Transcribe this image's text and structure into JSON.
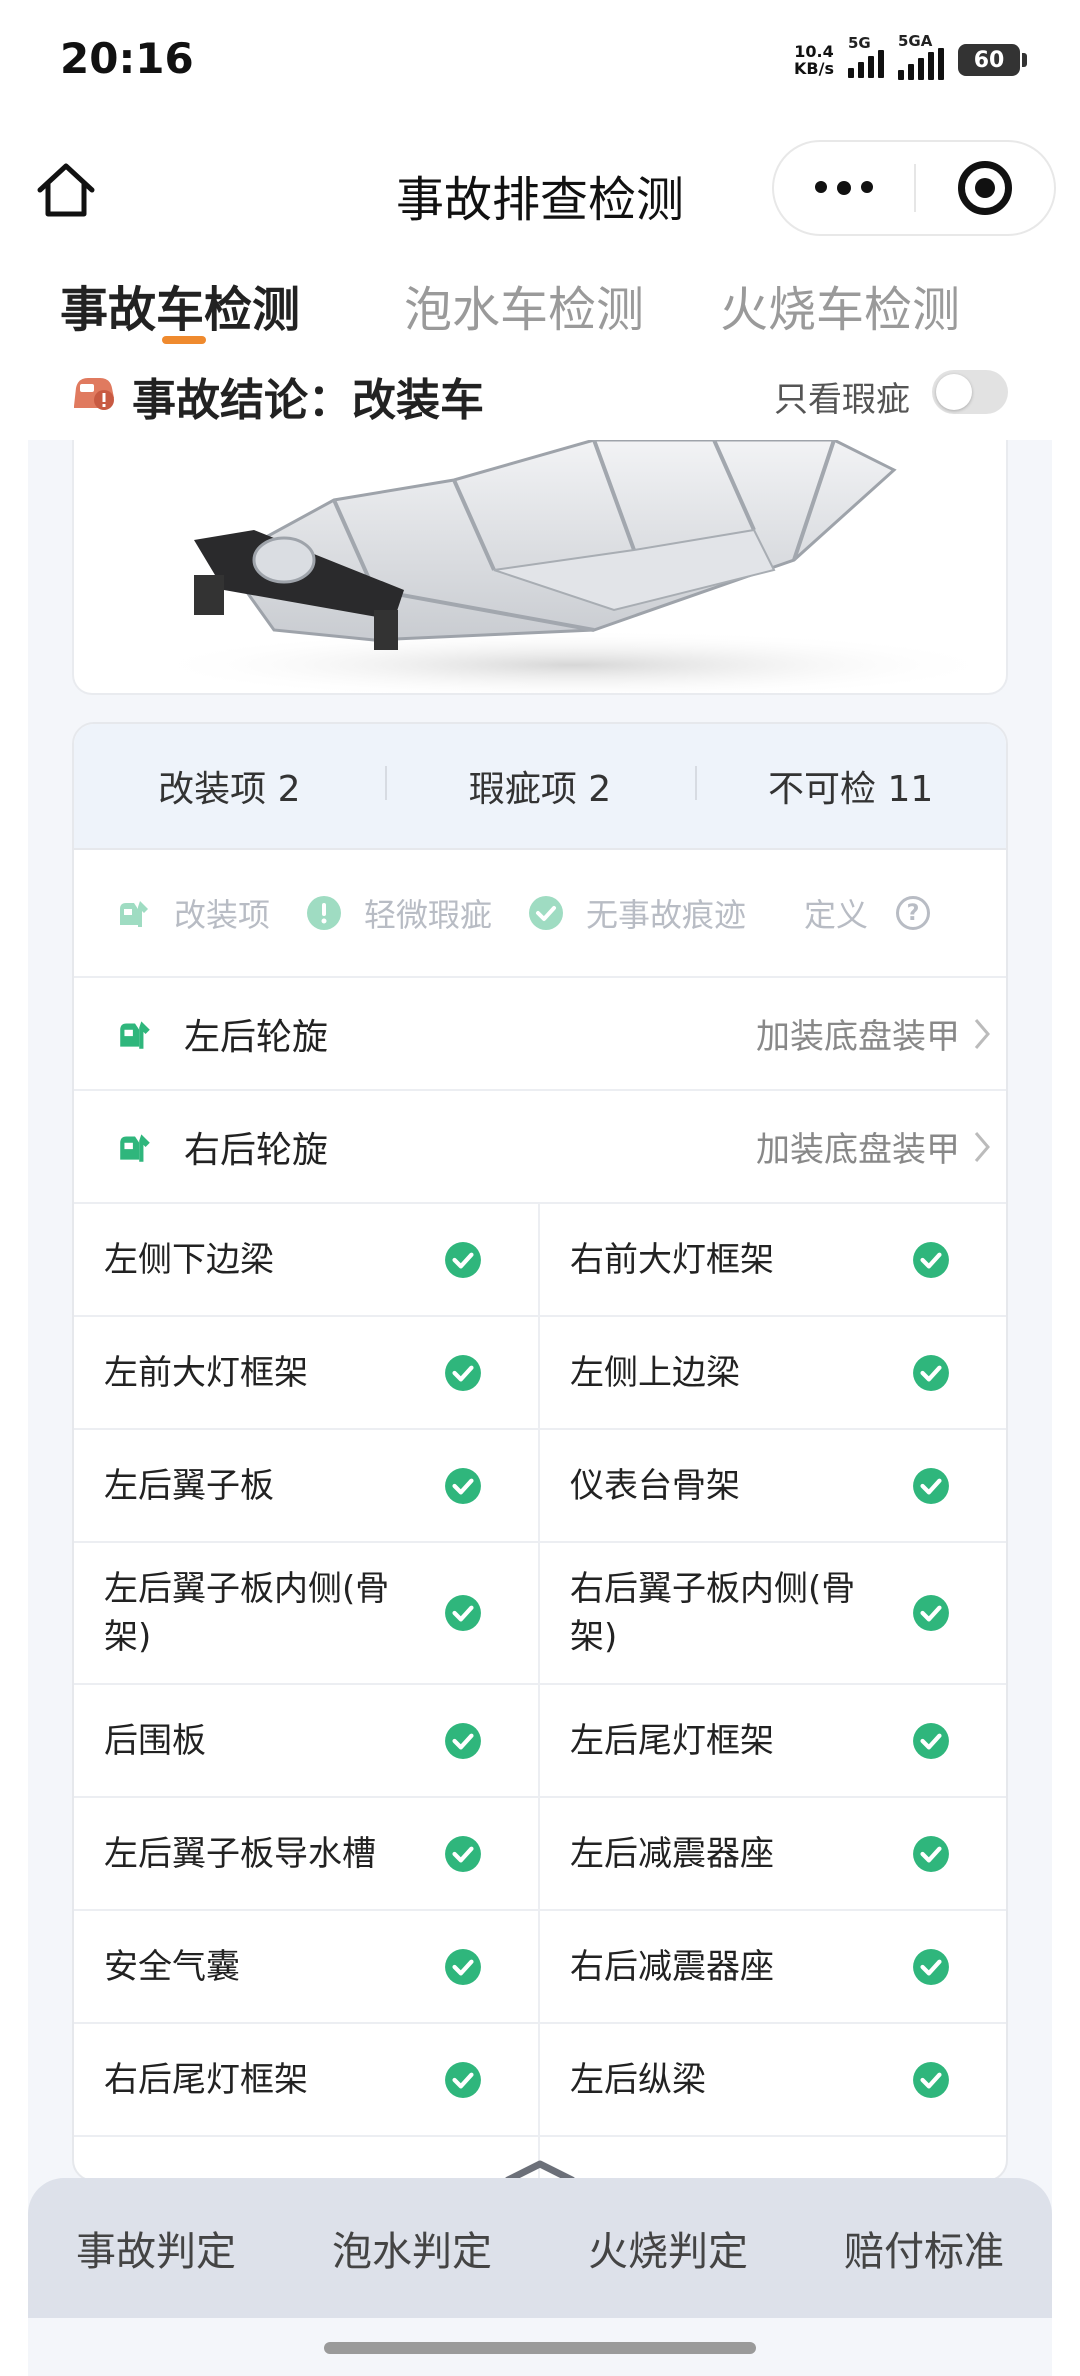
{
  "status_bar": {
    "time": "20:16",
    "net_speed_value": "10.4",
    "net_speed_unit": "KB/s",
    "signal1_label": "5G",
    "signal2_label": "5GA",
    "battery": "60"
  },
  "header": {
    "title": "事故排查检测",
    "icons": [
      "home-icon",
      "more-dots-icon",
      "target-icon"
    ]
  },
  "tabs": [
    {
      "label": "事故车检测",
      "active": true
    },
    {
      "label": "泡水车检测",
      "active": false
    },
    {
      "label": "火烧车检测",
      "active": false
    }
  ],
  "conclusion": {
    "label": "事故结论：改装车",
    "only_flaw_label": "只看瑕疵",
    "only_flaw_on": false
  },
  "summary": [
    {
      "label": "改装项 2"
    },
    {
      "label": "瑕疵项 2"
    },
    {
      "label": "不可检 11"
    }
  ],
  "legend": {
    "modified": "改装项",
    "minor_flaw": "轻微瑕疵",
    "no_accident": "无事故痕迹",
    "definition": "定义",
    "question_mark": "?"
  },
  "modified_items": [
    {
      "name": "左后轮旋",
      "value": "加装底盘装甲"
    },
    {
      "name": "右后轮旋",
      "value": "加装底盘装甲"
    }
  ],
  "check_items": [
    "左侧下边梁",
    "右前大灯框架",
    "左前大灯框架",
    "左侧上边梁",
    "左后翼子板",
    "仪表台骨架",
    "左后翼子板内侧(骨架)",
    "右后翼子板内侧(骨架)",
    "后围板",
    "左后尾灯框架",
    "左后翼子板导水槽",
    "左后减震器座",
    "安全气囊",
    "右后减震器座",
    "右后尾灯框架",
    "左后纵梁"
  ],
  "bottom_nav": [
    "事故判定",
    "泡水判定",
    "火烧判定",
    "赔付标准"
  ],
  "colors": {
    "accent_orange": "#ef8a2e",
    "check_green": "#2fb67c",
    "card_header_bg": "#eef3fa"
  }
}
